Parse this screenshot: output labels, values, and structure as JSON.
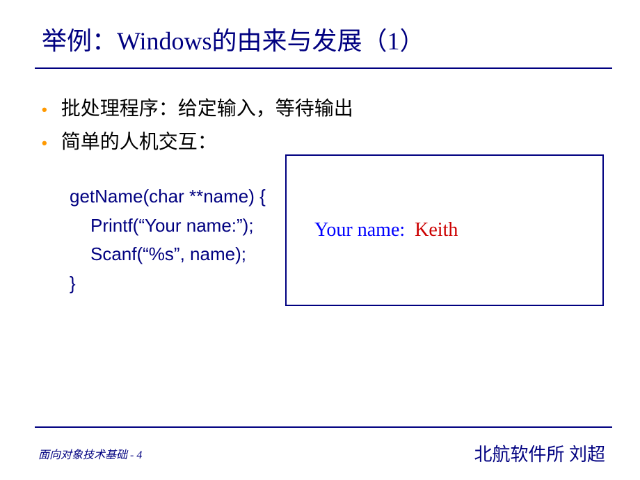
{
  "title": "举例：Windows的由来与发展（1）",
  "bullets": [
    "批处理程序：给定输入，等待输出",
    "简单的人机交互："
  ],
  "code": {
    "line1": "getName(char **name) {",
    "line2": "Printf(“Your name:”);",
    "line3": "Scanf(“%s”, name);",
    "line4": "}"
  },
  "output": {
    "label": "Your name:",
    "value": "Keith"
  },
  "footer": {
    "left": "面向对象技术基础 - 4",
    "right": "北航软件所  刘超"
  }
}
